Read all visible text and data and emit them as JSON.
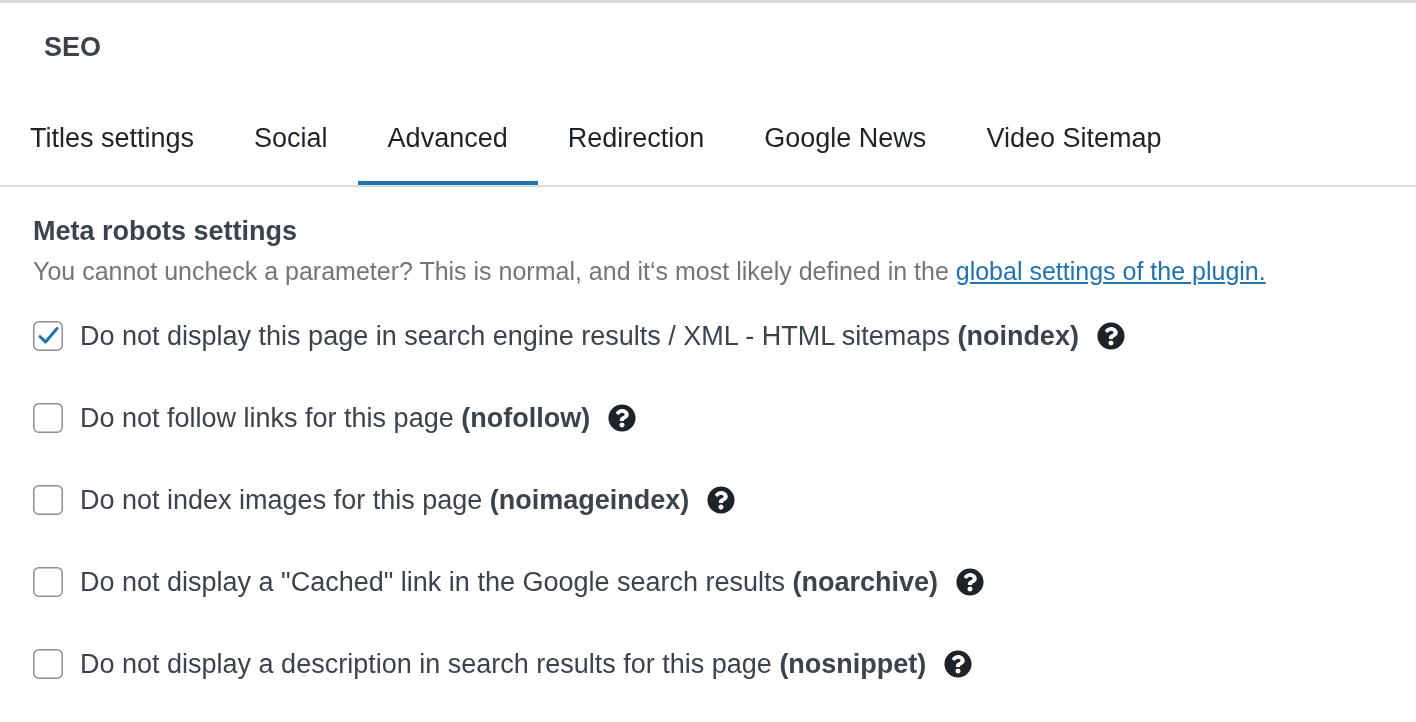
{
  "panel": {
    "title": "SEO"
  },
  "tabs": [
    {
      "label": "Titles settings",
      "selected": false
    },
    {
      "label": "Social",
      "selected": false
    },
    {
      "label": "Advanced",
      "selected": true
    },
    {
      "label": "Redirection",
      "selected": false
    },
    {
      "label": "Google News",
      "selected": false
    },
    {
      "label": "Video Sitemap",
      "selected": false
    }
  ],
  "section": {
    "heading": "Meta robots settings",
    "description": "You cannot uncheck a parameter? This is normal, and it‘s most likely defined in the",
    "link": "global settings of the plugin."
  },
  "options": [
    {
      "label": "Do not display this page in search engine results / XML - HTML sitemaps **(noindex)**",
      "checked": true
    },
    {
      "label": "Do not follow links for this page **(nofollow)**",
      "checked": false
    },
    {
      "label": "Do not index images for this page **(noimageindex)**",
      "checked": false
    },
    {
      "label": "Do not display a \"Cached\" link in the Google search results **(noarchive)**",
      "checked": false
    },
    {
      "label": "Do not display a description in search results for this page **(nosnippet)**",
      "checked": false
    }
  ]
}
